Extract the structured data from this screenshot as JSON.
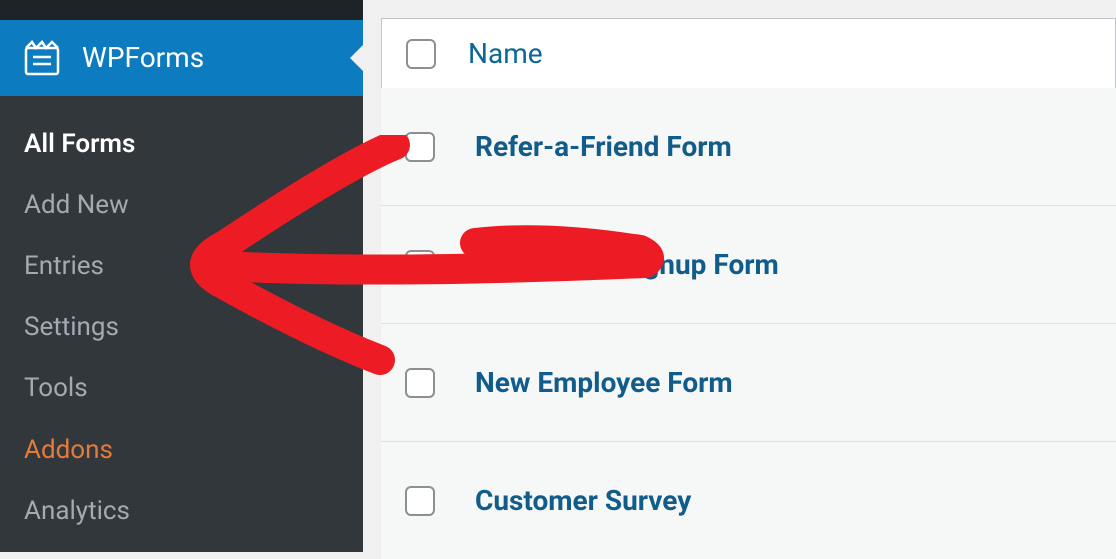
{
  "sidebar": {
    "brand": "WPForms",
    "items": [
      {
        "label": "All Forms",
        "active": true
      },
      {
        "label": "Add New",
        "active": false
      },
      {
        "label": "Entries",
        "active": false
      },
      {
        "label": "Settings",
        "active": false
      },
      {
        "label": "Tools",
        "active": false
      },
      {
        "label": "Addons",
        "active": false,
        "highlight": "orange"
      },
      {
        "label": "Analytics",
        "active": false
      }
    ]
  },
  "table": {
    "column_name": "Name",
    "rows": [
      {
        "name": "Refer-a-Friend Form"
      },
      {
        "name": "Newsletter Signup Form"
      },
      {
        "name": "New Employee Form"
      },
      {
        "name": "Customer Survey"
      }
    ]
  }
}
